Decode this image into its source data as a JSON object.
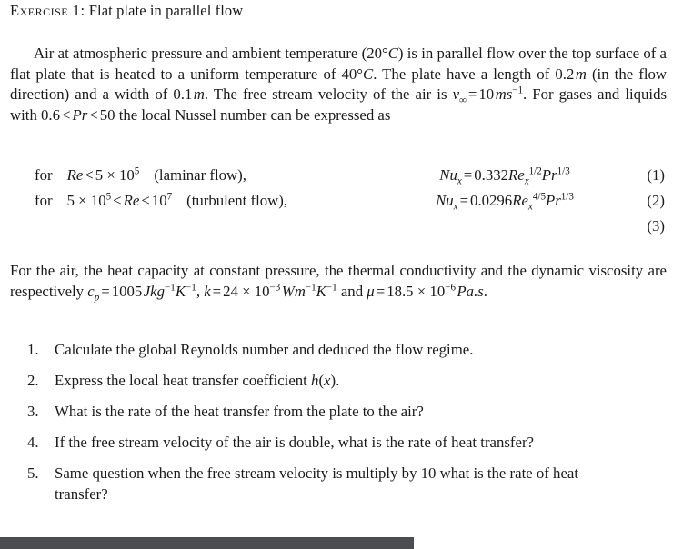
{
  "document": {
    "title_label": "Exercise 1:",
    "title_text": "Flat plate in parallel flow",
    "intro": {
      "seg1": "Air at atmospheric pressure and ambient temperature (",
      "temp_ambient": "20",
      "deg": "°",
      "unit_C": "C",
      "seg2": ") is in parallel flow over the top surface of a flat plate that is heated to a uniform temperature of ",
      "temp_plate": "40",
      "seg3": ". The plate have a length of ",
      "length_value": "0.2",
      "length_unit": "m",
      "seg4": " (in the flow direction) and a width of ",
      "width_value": "0.1",
      "width_unit": "m",
      "seg5": ". The free stream velocity of the air is ",
      "velocity_symbol": "v",
      "velocity_sub": "∞",
      "equals": "=",
      "velocity_value": "10",
      "velocity_unit": "ms",
      "velocity_unit_exp": "−1",
      "seg6": ". For gases and liquids with ",
      "pr_low": "0.6",
      "lt": "<",
      "pr_symbol": "Pr",
      "pr_high": "50",
      "seg7": " the local Nussel number can be expressed as"
    },
    "conditions": [
      {
        "keyword": "for",
        "criterion_symbol": "Re",
        "criterion_op": "<",
        "criterion_value": "5 × 10",
        "criterion_exp": "5",
        "regime": "(laminar flow),"
      },
      {
        "keyword": "for",
        "criterion_prefix_value": "5 × 10",
        "criterion_prefix_exp": "5",
        "criterion_op": "<",
        "criterion_symbol": "Re",
        "criterion_op2": "<",
        "criterion_value": "10",
        "criterion_exp": "7",
        "regime": "(turbulent flow),"
      }
    ],
    "equations": [
      {
        "lhs_symbol": "Nu",
        "lhs_sub": "x",
        "equals": "=",
        "coefficient": "0.332",
        "re_symbol": "Re",
        "re_sub": "x",
        "re_exp": "1/2",
        "pr_symbol": "Pr",
        "pr_exp": "1/3",
        "number": "(1)"
      },
      {
        "lhs_symbol": "Nu",
        "lhs_sub": "x",
        "equals": "=",
        "coefficient": "0.0296",
        "re_symbol": "Re",
        "re_sub": "x",
        "re_exp": "4/5",
        "pr_symbol": "Pr",
        "pr_exp": "1/3",
        "number": "(2)"
      },
      {
        "lhs_symbol": "",
        "lhs_sub": "",
        "equals": "",
        "coefficient": "",
        "re_symbol": "",
        "re_sub": "",
        "re_exp": "",
        "pr_symbol": "",
        "pr_exp": "",
        "number": "(3)"
      }
    ],
    "properties": {
      "seg1": "For the air, the heat capacity at constant pressure, the thermal conductivity and the dynamic viscosity are respectively ",
      "cp_symbol": "c",
      "cp_sub": "p",
      "equals": "=",
      "cp_value": "1005",
      "cp_unit_1": "Jkg",
      "cp_unit_1_exp": "−1",
      "cp_unit_2": "K",
      "cp_unit_2_exp": "−1",
      "comma": ", ",
      "k_symbol": "k",
      "k_value": "24 × 10",
      "k_exp": "−3",
      "k_unit_1": "Wm",
      "k_unit_1_exp": "−1",
      "k_unit_2": "K",
      "k_unit_2_exp": "−1",
      "seg2": "and ",
      "mu_symbol": "μ",
      "mu_value": "18.5 × 10",
      "mu_exp": "−6",
      "mu_unit": "Pa.s",
      "period": "."
    },
    "questions": [
      {
        "number": "1.",
        "text": "Calculate the global Reynolds number and deduced the flow regime."
      },
      {
        "number": "2.",
        "text_before": "Express the local heat transfer coefficient ",
        "math_h": "h",
        "math_open": "(",
        "math_x": "x",
        "math_close": ")",
        "text_after": "."
      },
      {
        "number": "3.",
        "text": "What is the rate of the heat transfer from the plate to the air?"
      },
      {
        "number": "4.",
        "text": "If the free stream velocity of the air is double, what is the rate of heat transfer?"
      },
      {
        "number": "5.",
        "text": "Same question when the free stream velocity is multiply by 10 what is the rate of heat transfer?"
      }
    ]
  },
  "scrollbar": {
    "orientation": "horizontal",
    "thumb_color": "#4c4d50",
    "track_color": "#ffffff"
  }
}
